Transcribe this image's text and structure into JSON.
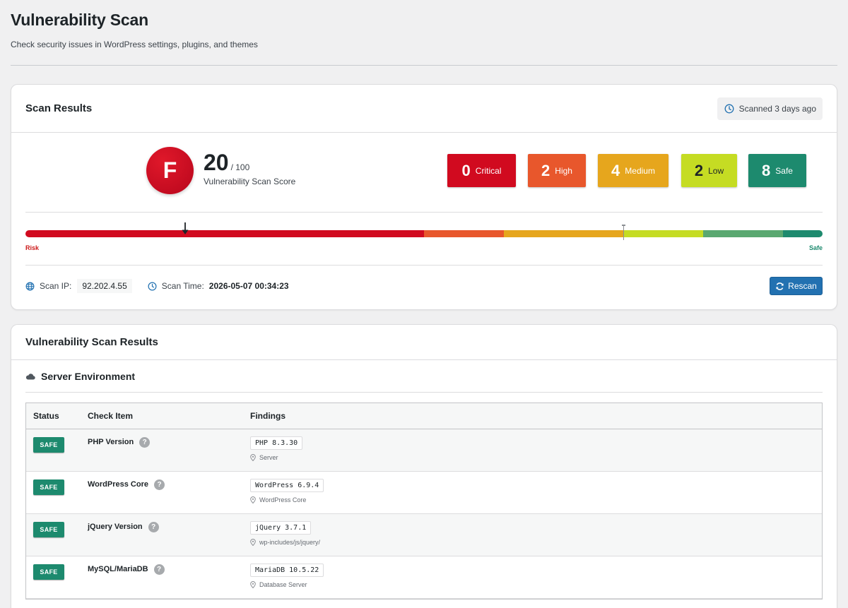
{
  "page": {
    "title": "Vulnerability Scan",
    "subtitle": "Check security issues in WordPress settings, plugins, and themes"
  },
  "scan_results": {
    "title": "Scan Results",
    "scanned_ago": "Scanned 3 days ago",
    "grade": "F",
    "score": "20",
    "score_max": "/ 100",
    "score_caption": "Vulnerability Scan Score",
    "score_value": 20,
    "severity": [
      {
        "count": "0",
        "label": "Critical",
        "bg": "#d10a1f",
        "fg": "#ffffff"
      },
      {
        "count": "2",
        "label": "High",
        "bg": "#e8572c",
        "fg": "#ffffff"
      },
      {
        "count": "4",
        "label": "Medium",
        "bg": "#e6a61d",
        "fg": "#ffffff"
      },
      {
        "count": "2",
        "label": "Low",
        "bg": "#c5dc23",
        "fg": "#1d2327"
      },
      {
        "count": "8",
        "label": "Safe",
        "bg": "#1d8a6e",
        "fg": "#ffffff"
      }
    ],
    "bar_colors": [
      "#d10a1f",
      "#e8572c",
      "#e6a61d",
      "#c5dc23",
      "#5aa870",
      "#1d8a6e"
    ],
    "bar_label_left": "Risk",
    "bar_label_right": "Safe",
    "scan_ip_label": "Scan IP:",
    "scan_ip": "92.202.4.55",
    "scan_time_label": "Scan Time:",
    "scan_time": "2026-05-07 00:34:23",
    "rescan_label": "Rescan"
  },
  "vuln_results": {
    "title": "Vulnerability Scan Results",
    "section": "Server Environment",
    "columns": [
      "Status",
      "Check Item",
      "Findings"
    ],
    "rows": [
      {
        "status": "SAFE",
        "item": "PHP Version",
        "finding": "PHP 8.3.30",
        "location": "Server"
      },
      {
        "status": "SAFE",
        "item": "WordPress Core",
        "finding": "WordPress 6.9.4",
        "location": "WordPress Core"
      },
      {
        "status": "SAFE",
        "item": "jQuery Version",
        "finding": "jQuery 3.7.1",
        "location": "wp-includes/js/jquery/"
      },
      {
        "status": "SAFE",
        "item": "MySQL/MariaDB",
        "finding": "MariaDB 10.5.22",
        "location": "Database Server"
      }
    ]
  }
}
